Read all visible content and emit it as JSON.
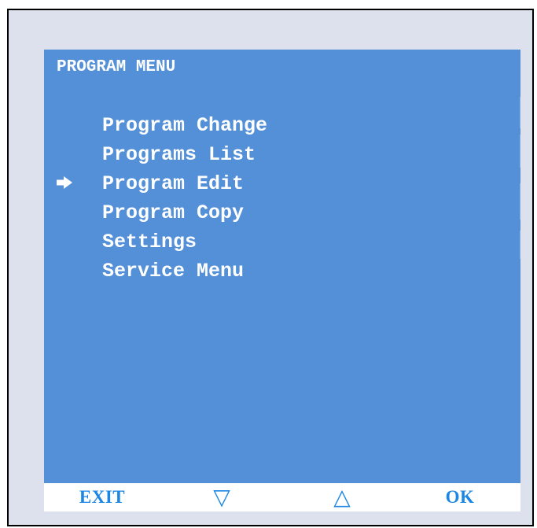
{
  "screen": {
    "title": "PROGRAM MENU",
    "menu_items": [
      {
        "label": "Program Change",
        "selected": false
      },
      {
        "label": "Programs List",
        "selected": false
      },
      {
        "label": "Program Edit",
        "selected": true
      },
      {
        "label": "Program Copy",
        "selected": false
      },
      {
        "label": "Settings",
        "selected": false
      },
      {
        "label": "Service Menu",
        "selected": false
      }
    ],
    "selection_icon": "right-arrow-icon"
  },
  "softkeys": {
    "exit_label": "EXIT",
    "down_glyph": "▽",
    "down_icon": "down-triangle-icon",
    "up_glyph": "△",
    "up_icon": "up-triangle-icon",
    "ok_label": "OK"
  },
  "colors": {
    "frame_background": "#dde1ee",
    "screen_background": "#5390d8",
    "screen_text": "#ffffff",
    "softkey_bar": "#ffffff",
    "softkey_text": "#1b86e3"
  }
}
